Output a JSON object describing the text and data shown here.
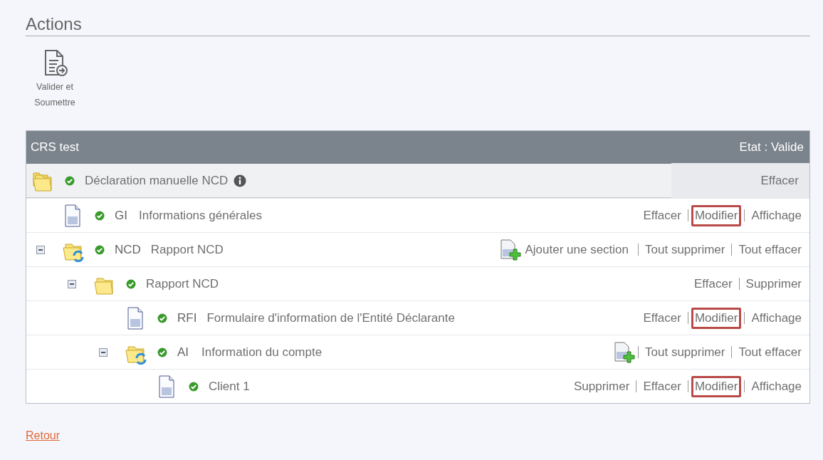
{
  "section_title": "Actions",
  "toolbar": [
    {
      "label": "Valider et Soumettre"
    }
  ],
  "panel": {
    "title": "CRS test",
    "status": "Etat : Valide",
    "tree": [
      {
        "kind": "folders",
        "name": "Déclaration manuelle NCD",
        "info": true,
        "actions": [
          {
            "kind": "link",
            "label": "Effacer",
            "highlighted": false
          }
        ],
        "children": [
          {
            "kind": "document",
            "code": "GI",
            "name": "Informations générales",
            "actions": [
              {
                "kind": "link",
                "label": "Effacer",
                "highlighted": false
              },
              {
                "kind": "link",
                "label": "Modifier",
                "highlighted": true
              },
              {
                "kind": "link",
                "label": "Affichage",
                "highlighted": false
              }
            ]
          },
          {
            "kind": "folder-sync",
            "code": "NCD",
            "name": "Rapport NCD",
            "expanded": true,
            "actions": [
              {
                "kind": "add",
                "label": "Ajouter une section",
                "highlighted": false
              },
              {
                "kind": "link",
                "label": "Tout supprimer",
                "highlighted": false
              },
              {
                "kind": "link",
                "label": "Tout effacer",
                "highlighted": false
              }
            ],
            "children": [
              {
                "kind": "folder",
                "name": "Rapport NCD",
                "expanded": true,
                "actions": [
                  {
                    "kind": "link",
                    "label": "Effacer",
                    "highlighted": false
                  },
                  {
                    "kind": "link",
                    "label": "Supprimer",
                    "highlighted": false
                  }
                ],
                "children": [
                  {
                    "kind": "document",
                    "code": "RFI",
                    "name": "Formulaire d'information de l'Entité Déclarante",
                    "actions": [
                      {
                        "kind": "link",
                        "label": "Effacer",
                        "highlighted": false
                      },
                      {
                        "kind": "link",
                        "label": "Modifier",
                        "highlighted": true
                      },
                      {
                        "kind": "link",
                        "label": "Affichage",
                        "highlighted": false
                      }
                    ]
                  },
                  {
                    "kind": "folder-sync",
                    "code": "AI",
                    "name": "Information du compte",
                    "expanded": true,
                    "actions": [
                      {
                        "kind": "add"
                      },
                      {
                        "kind": "link",
                        "label": "Tout supprimer",
                        "highlighted": false
                      },
                      {
                        "kind": "link",
                        "label": "Tout effacer",
                        "highlighted": false
                      }
                    ],
                    "children": [
                      {
                        "kind": "document",
                        "name": "Client 1",
                        "actions": [
                          {
                            "kind": "link",
                            "label": "Supprimer",
                            "highlighted": false
                          },
                          {
                            "kind": "link",
                            "label": "Effacer",
                            "highlighted": false
                          },
                          {
                            "kind": "link",
                            "label": "Modifier",
                            "highlighted": true
                          },
                          {
                            "kind": "link",
                            "label": "Affichage",
                            "highlighted": false
                          }
                        ]
                      }
                    ]
                  }
                ]
              }
            ]
          }
        ]
      }
    ]
  },
  "back_link": "Retour"
}
